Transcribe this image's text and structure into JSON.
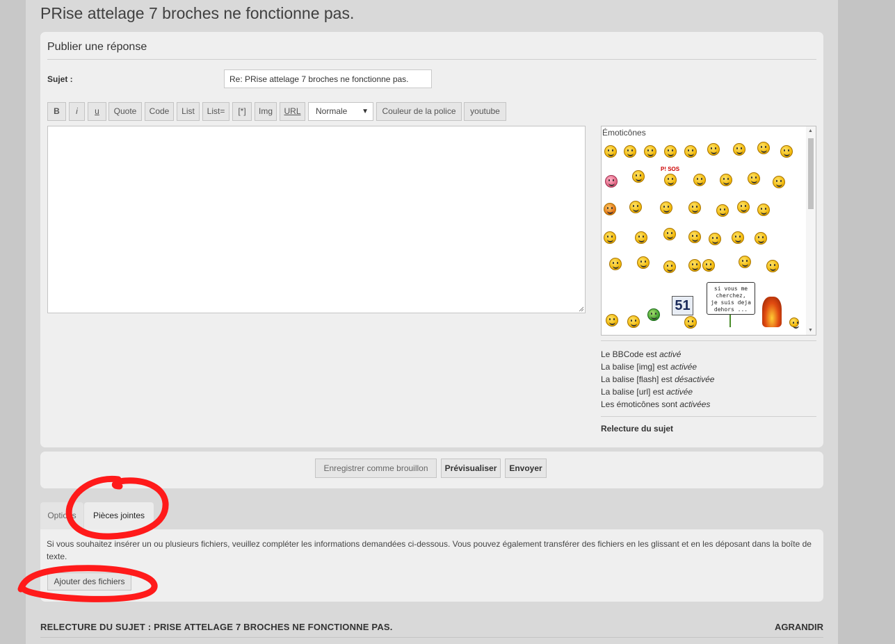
{
  "topic": {
    "title": "PRise attelage 7 broches ne fonctionne pas."
  },
  "reply_panel": {
    "title": "Publier une réponse",
    "subject_label": "Sujet :",
    "subject_value": "Re: PRise attelage 7 broches ne fonctionne pas."
  },
  "toolbar": {
    "bold": "B",
    "italic": "i",
    "underline": "u",
    "quote": "Quote",
    "code": "Code",
    "list": "List",
    "list_ordered": "List=",
    "list_item": "[*]",
    "img": "Img",
    "url": "URL",
    "font_size": "Normale",
    "font_color": "Couleur de la police",
    "youtube": "youtube"
  },
  "smilies": {
    "title": "Émoticônes",
    "sign_line1": "si vous me",
    "sign_line2": "cherchez,",
    "sign_line3": "je suis deja",
    "sign_line4": "dehors ...",
    "sign_51": "51",
    "sos_label": "P! SOS"
  },
  "bbcode_info": {
    "bbcode_prefix": "Le BBCode est ",
    "bbcode_state": "activé",
    "img_prefix": "La balise [img] est ",
    "img_state": "activée",
    "flash_prefix": "La balise [flash] est ",
    "flash_state": "désactivée",
    "url_prefix": "La balise [url] est ",
    "url_state": "activée",
    "smilies_prefix": "Les émoticônes sont ",
    "smilies_state": "activées",
    "review_link": "Relecture du sujet"
  },
  "actions": {
    "save_draft": "Enregistrer comme brouillon",
    "preview": "Prévisualiser",
    "submit": "Envoyer"
  },
  "tabs": {
    "options": "Options",
    "attachments": "Pièces jointes"
  },
  "attachments": {
    "help_text": "Si vous souhaitez insérer un ou plusieurs fichiers, veuillez compléter les informations demandées ci-dessous. Vous pouvez également transférer des fichiers en les glissant et en les déposant dans la boîte de texte.",
    "add_files": "Ajouter des fichiers"
  },
  "review": {
    "title": "RELECTURE DU SUJET : PRISE ATTELAGE 7 BROCHES NE FONCTIONNE PAS.",
    "expand": "AGRANDIR"
  },
  "colors": {
    "annotation": "#ff1a1a",
    "panel": "#efefef",
    "page": "#d9d9d9"
  }
}
